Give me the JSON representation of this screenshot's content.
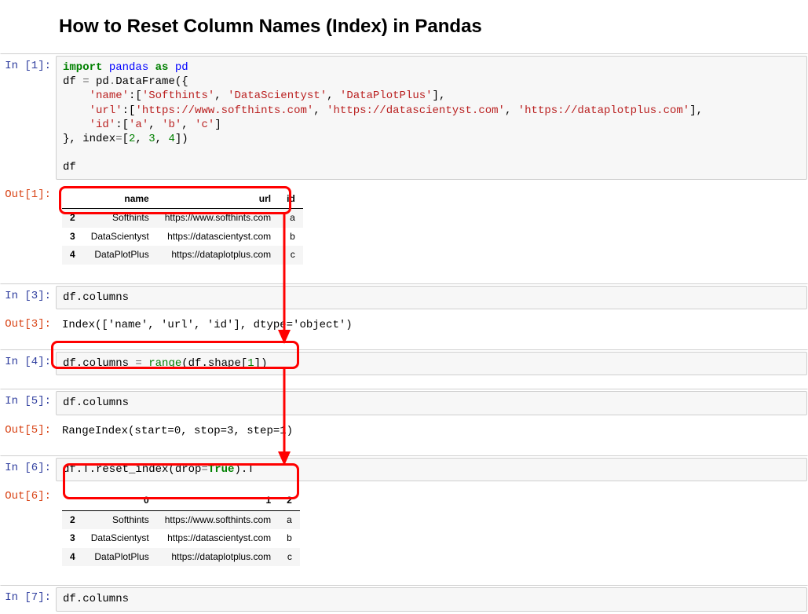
{
  "title": "How to Reset Column Names (Index) in Pandas",
  "cells": {
    "in1_prompt": "In [1]:",
    "out1_prompt": "Out[1]:",
    "in3_prompt": "In [3]:",
    "out3_prompt": "Out[3]:",
    "in4_prompt": "In [4]:",
    "in5_prompt": "In [5]:",
    "out5_prompt": "Out[5]:",
    "in6_prompt": "In [6]:",
    "out6_prompt": "Out[6]:",
    "in7_prompt": "In [7]:"
  },
  "code": {
    "c1_l1_import": "import",
    "c1_l1_pandas": "pandas",
    "c1_l1_as": "as",
    "c1_l1_pd": "pd",
    "c1_l2_a": "df ",
    "c1_l2_eq": "=",
    "c1_l2_b": " pd",
    "c1_l2_dot": ".",
    "c1_l2_c": "DataFrame({",
    "c1_l3_ind": "    ",
    "c1_l3_k": "'name'",
    "c1_l3_c": ":[",
    "c1_l3_v1": "'Softhints'",
    "c1_l3_s": ", ",
    "c1_l3_v2": "'DataScientyst'",
    "c1_l3_v3": "'DataPlotPlus'",
    "c1_l3_e": "],",
    "c1_l4_k": "'url'",
    "c1_l4_v1": "'https://www.softhints.com'",
    "c1_l4_v2": "'https://datascientyst.com'",
    "c1_l4_v3": "'https://dataplotplus.com'",
    "c1_l5_k": "'id'",
    "c1_l5_v1": "'a'",
    "c1_l5_v2": "'b'",
    "c1_l5_v3": "'c'",
    "c1_l5_e": "]",
    "c1_l6_a": "}, index",
    "c1_l6_eq": "=",
    "c1_l6_b": "[",
    "c1_l6_n1": "2",
    "c1_l6_n2": "3",
    "c1_l6_n3": "4",
    "c1_l6_e": "])",
    "c1_l8": "df",
    "c3": "df.columns",
    "out3": "Index(['name', 'url', 'id'], dtype='object')",
    "c4_a": "df.columns ",
    "c4_eq": "=",
    "c4_b": " ",
    "c4_range": "range",
    "c4_c": "(df.shape[",
    "c4_n": "1",
    "c4_d": "])",
    "c5": "df.columns",
    "out5": "RangeIndex(start=0, stop=3, step=1)",
    "c6_a": "df.T.reset_index(drop",
    "c6_eq": "=",
    "c6_true": "True",
    "c6_b": ").T",
    "c7": "df.columns"
  },
  "table1": {
    "headers": [
      "",
      "name",
      "url",
      "id"
    ],
    "rows": [
      {
        "idx": "2",
        "name": "Softhints",
        "url": "https://www.softhints.com",
        "id": "a"
      },
      {
        "idx": "3",
        "name": "DataScientyst",
        "url": "https://datascientyst.com",
        "id": "b"
      },
      {
        "idx": "4",
        "name": "DataPlotPlus",
        "url": "https://dataplotplus.com",
        "id": "c"
      }
    ]
  },
  "table2": {
    "headers": [
      "",
      "0",
      "1",
      "2"
    ],
    "rows": [
      {
        "idx": "2",
        "c0": "Softhints",
        "c1": "https://www.softhints.com",
        "c2": "a"
      },
      {
        "idx": "3",
        "c0": "DataScientyst",
        "c1": "https://datascientyst.com",
        "c2": "b"
      },
      {
        "idx": "4",
        "c0": "DataPlotPlus",
        "c1": "https://dataplotplus.com",
        "c2": "c"
      }
    ]
  }
}
